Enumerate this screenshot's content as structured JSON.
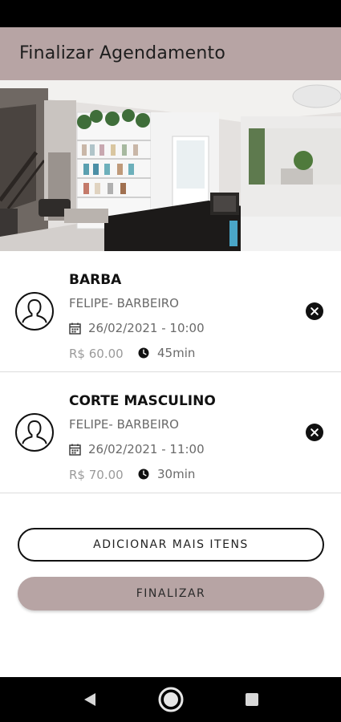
{
  "app_bar": {
    "title": "Finalizar Agendamento"
  },
  "hero": {
    "image": "salon-interior-photo"
  },
  "items": [
    {
      "name": "BARBA",
      "professional": "FELIPE- BARBEIRO",
      "datetime": "26/02/2021 - 10:00",
      "price": "R$ 60.00",
      "duration": "45min"
    },
    {
      "name": "CORTE MASCULINO",
      "professional": "FELIPE- BARBEIRO",
      "datetime": "26/02/2021 - 11:00",
      "price": "R$ 70.00",
      "duration": "30min"
    }
  ],
  "buttons": {
    "add_more": "ADICIONAR MAIS ITENS",
    "finish": "FINALIZAR"
  },
  "icons": {
    "avatar": "person-outline-icon",
    "calendar": "calendar-icon",
    "clock": "clock-icon",
    "remove": "close-circle-icon",
    "nav_back": "back-triangle-icon",
    "nav_home": "home-circle-icon",
    "nav_recents": "recents-square-icon"
  },
  "colors": {
    "accent": "#b7a4a4",
    "text_primary": "#111111",
    "text_secondary": "#6a6a6a",
    "price": "#9a9a9a"
  }
}
